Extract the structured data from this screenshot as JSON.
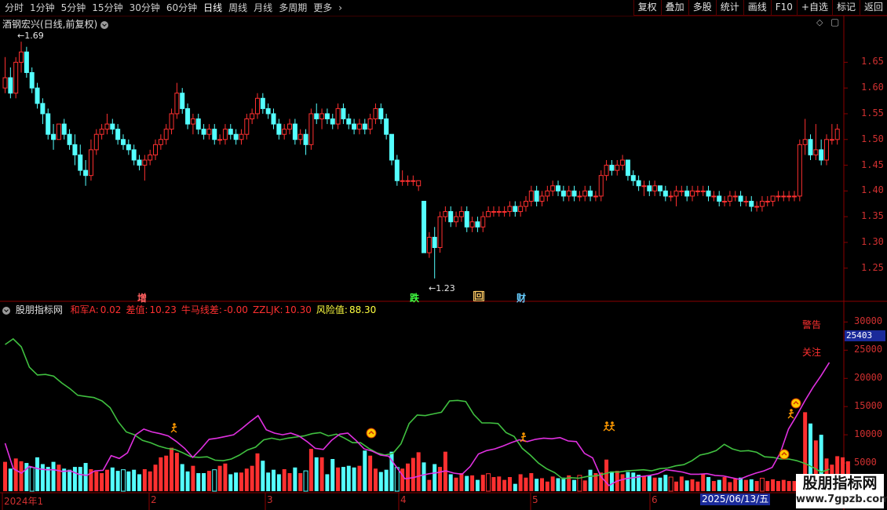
{
  "toolbar": {
    "periods": [
      "分时",
      "1分钟",
      "5分钟",
      "15分钟",
      "30分钟",
      "60分钟",
      "日线",
      "周线",
      "月线",
      "多周期",
      "更多"
    ],
    "active": "日线",
    "buttons": [
      "复权",
      "叠加",
      "多股",
      "统计",
      "画线",
      "F10",
      "+自选",
      "标记",
      "返回"
    ]
  },
  "stock": {
    "title": "酒钢宏兴(日线,前复权)",
    "high_label": "1.69",
    "low_label": "1.23"
  },
  "event_marks": [
    {
      "text": "增",
      "color": "#ff6060"
    },
    {
      "text": "跌",
      "color": "#40ff40"
    },
    {
      "text": "回",
      "color": "#ffcc66"
    },
    {
      "text": "财",
      "color": "#66ccff"
    }
  ],
  "price_axis": [
    "1.65",
    "1.60",
    "1.55",
    "1.50",
    "1.45",
    "1.40",
    "1.35",
    "1.30",
    "1.25"
  ],
  "indicator": {
    "name": "股朋指标网",
    "items": [
      {
        "label": "和军A:",
        "value": "0.02",
        "color": "#ff3030"
      },
      {
        "label": "差值:",
        "value": "10.23",
        "color": "#ff3030"
      },
      {
        "label": "牛马线差:",
        "value": "-0.00",
        "color": "#ff3030"
      },
      {
        "label": "ZZLJK:",
        "value": "10.30",
        "color": "#ff3030"
      },
      {
        "label": "风险值:",
        "value": "88.30",
        "color": "#ffff40"
      }
    ],
    "warning_label": "警告",
    "focus_label": "关注"
  },
  "volume_axis": [
    "30000",
    "25000",
    "20000",
    "15000",
    "10000",
    "5000"
  ],
  "highlight_value": "25403",
  "x_axis": [
    "2024年1",
    "2",
    "3",
    "4",
    "5",
    "6"
  ],
  "date_label": "2025/06/13/五",
  "brand": {
    "title": "股朋指标网",
    "url": "www.7gpzb.com"
  },
  "colors": {
    "up": "#ff3030",
    "down": "#54ffff",
    "green_line": "#40c040",
    "magenta_line": "#e030e0",
    "grid": "#8b0000"
  },
  "chart_data": {
    "type": "candlestick",
    "candles": [
      [
        1.6,
        1.66,
        1.59,
        1.62
      ],
      [
        1.62,
        1.64,
        1.58,
        1.59
      ],
      [
        1.59,
        1.66,
        1.58,
        1.65
      ],
      [
        1.65,
        1.69,
        1.63,
        1.67
      ],
      [
        1.67,
        1.68,
        1.62,
        1.63
      ],
      [
        1.63,
        1.64,
        1.59,
        1.6
      ],
      [
        1.6,
        1.61,
        1.56,
        1.57
      ],
      [
        1.57,
        1.58,
        1.53,
        1.55
      ],
      [
        1.55,
        1.56,
        1.5,
        1.51
      ],
      [
        1.51,
        1.53,
        1.48,
        1.5
      ],
      [
        1.5,
        1.53,
        1.5,
        1.53
      ],
      [
        1.53,
        1.54,
        1.5,
        1.51
      ],
      [
        1.51,
        1.52,
        1.48,
        1.49
      ],
      [
        1.49,
        1.51,
        1.45,
        1.47
      ],
      [
        1.47,
        1.49,
        1.43,
        1.44
      ],
      [
        1.44,
        1.46,
        1.41,
        1.43
      ],
      [
        1.43,
        1.5,
        1.42,
        1.48
      ],
      [
        1.48,
        1.52,
        1.47,
        1.51
      ],
      [
        1.51,
        1.53,
        1.5,
        1.52
      ],
      [
        1.52,
        1.55,
        1.51,
        1.53
      ],
      [
        1.53,
        1.54,
        1.51,
        1.52
      ],
      [
        1.52,
        1.53,
        1.49,
        1.5
      ],
      [
        1.5,
        1.51,
        1.48,
        1.49
      ],
      [
        1.49,
        1.5,
        1.47,
        1.48
      ],
      [
        1.48,
        1.49,
        1.45,
        1.46
      ],
      [
        1.46,
        1.47,
        1.44,
        1.45
      ],
      [
        1.45,
        1.47,
        1.42,
        1.46
      ],
      [
        1.46,
        1.48,
        1.45,
        1.47
      ],
      [
        1.47,
        1.5,
        1.46,
        1.49
      ],
      [
        1.49,
        1.51,
        1.48,
        1.5
      ],
      [
        1.5,
        1.53,
        1.49,
        1.52
      ],
      [
        1.52,
        1.56,
        1.51,
        1.55
      ],
      [
        1.55,
        1.61,
        1.54,
        1.59
      ],
      [
        1.59,
        1.6,
        1.55,
        1.56
      ],
      [
        1.56,
        1.57,
        1.52,
        1.53
      ],
      [
        1.53,
        1.55,
        1.51,
        1.54
      ],
      [
        1.54,
        1.55,
        1.51,
        1.52
      ],
      [
        1.52,
        1.53,
        1.5,
        1.51
      ],
      [
        1.51,
        1.53,
        1.5,
        1.52
      ],
      [
        1.52,
        1.53,
        1.49,
        1.5
      ],
      [
        1.5,
        1.51,
        1.49,
        1.5
      ],
      [
        1.5,
        1.53,
        1.49,
        1.52
      ],
      [
        1.52,
        1.53,
        1.5,
        1.51
      ],
      [
        1.51,
        1.52,
        1.49,
        1.5
      ],
      [
        1.5,
        1.52,
        1.49,
        1.51
      ],
      [
        1.51,
        1.55,
        1.5,
        1.54
      ],
      [
        1.54,
        1.56,
        1.53,
        1.55
      ],
      [
        1.55,
        1.59,
        1.54,
        1.58
      ],
      [
        1.58,
        1.59,
        1.55,
        1.56
      ],
      [
        1.56,
        1.57,
        1.54,
        1.55
      ],
      [
        1.55,
        1.56,
        1.52,
        1.53
      ],
      [
        1.53,
        1.54,
        1.5,
        1.51
      ],
      [
        1.51,
        1.53,
        1.5,
        1.52
      ],
      [
        1.52,
        1.54,
        1.51,
        1.53
      ],
      [
        1.53,
        1.54,
        1.49,
        1.5
      ],
      [
        1.5,
        1.52,
        1.49,
        1.51
      ],
      [
        1.51,
        1.52,
        1.47,
        1.49
      ],
      [
        1.49,
        1.56,
        1.48,
        1.55
      ],
      [
        1.55,
        1.57,
        1.53,
        1.54
      ],
      [
        1.54,
        1.56,
        1.52,
        1.55
      ],
      [
        1.55,
        1.56,
        1.53,
        1.54
      ],
      [
        1.54,
        1.55,
        1.52,
        1.53
      ],
      [
        1.53,
        1.57,
        1.52,
        1.56
      ],
      [
        1.56,
        1.57,
        1.53,
        1.54
      ],
      [
        1.54,
        1.55,
        1.52,
        1.53
      ],
      [
        1.53,
        1.54,
        1.51,
        1.52
      ],
      [
        1.52,
        1.54,
        1.51,
        1.53
      ],
      [
        1.53,
        1.54,
        1.51,
        1.52
      ],
      [
        1.52,
        1.55,
        1.51,
        1.54
      ],
      [
        1.54,
        1.57,
        1.53,
        1.56
      ],
      [
        1.56,
        1.57,
        1.53,
        1.54
      ],
      [
        1.54,
        1.55,
        1.5,
        1.51
      ],
      [
        1.51,
        1.51,
        1.45,
        1.46
      ],
      [
        1.46,
        1.47,
        1.41,
        1.42
      ],
      [
        1.42,
        1.44,
        1.41,
        1.42
      ],
      [
        1.42,
        1.43,
        1.41,
        1.42
      ],
      [
        1.42,
        1.43,
        1.41,
        1.42
      ],
      [
        1.41,
        1.42,
        1.4,
        1.42
      ],
      [
        1.38,
        1.38,
        1.28,
        1.28
      ],
      [
        1.28,
        1.32,
        1.27,
        1.31
      ],
      [
        1.31,
        1.33,
        1.23,
        1.29
      ],
      [
        1.29,
        1.36,
        1.28,
        1.35
      ],
      [
        1.35,
        1.37,
        1.34,
        1.36
      ],
      [
        1.36,
        1.37,
        1.33,
        1.34
      ],
      [
        1.34,
        1.36,
        1.33,
        1.35
      ],
      [
        1.35,
        1.37,
        1.34,
        1.36
      ],
      [
        1.36,
        1.37,
        1.32,
        1.33
      ],
      [
        1.33,
        1.35,
        1.32,
        1.34
      ],
      [
        1.34,
        1.35,
        1.32,
        1.33
      ],
      [
        1.33,
        1.36,
        1.32,
        1.35
      ],
      [
        1.35,
        1.37,
        1.35,
        1.36
      ],
      [
        1.36,
        1.37,
        1.35,
        1.36
      ],
      [
        1.36,
        1.37,
        1.35,
        1.36
      ],
      [
        1.36,
        1.37,
        1.35,
        1.36
      ],
      [
        1.36,
        1.38,
        1.35,
        1.37
      ],
      [
        1.37,
        1.38,
        1.35,
        1.36
      ],
      [
        1.36,
        1.38,
        1.35,
        1.37
      ],
      [
        1.37,
        1.39,
        1.36,
        1.38
      ],
      [
        1.38,
        1.41,
        1.37,
        1.4
      ],
      [
        1.4,
        1.41,
        1.37,
        1.38
      ],
      [
        1.38,
        1.4,
        1.37,
        1.39
      ],
      [
        1.39,
        1.41,
        1.38,
        1.4
      ],
      [
        1.4,
        1.42,
        1.39,
        1.41
      ],
      [
        1.41,
        1.42,
        1.39,
        1.4
      ],
      [
        1.4,
        1.41,
        1.38,
        1.39
      ],
      [
        1.39,
        1.41,
        1.38,
        1.4
      ],
      [
        1.4,
        1.41,
        1.38,
        1.39
      ],
      [
        1.39,
        1.4,
        1.38,
        1.39
      ],
      [
        1.39,
        1.41,
        1.38,
        1.4
      ],
      [
        1.4,
        1.41,
        1.38,
        1.39
      ],
      [
        1.39,
        1.4,
        1.38,
        1.39
      ],
      [
        1.39,
        1.44,
        1.38,
        1.43
      ],
      [
        1.43,
        1.46,
        1.42,
        1.45
      ],
      [
        1.45,
        1.46,
        1.43,
        1.44
      ],
      [
        1.44,
        1.46,
        1.43,
        1.45
      ],
      [
        1.45,
        1.47,
        1.44,
        1.46
      ],
      [
        1.46,
        1.46,
        1.42,
        1.43
      ],
      [
        1.43,
        1.44,
        1.41,
        1.42
      ],
      [
        1.42,
        1.43,
        1.4,
        1.41
      ],
      [
        1.41,
        1.42,
        1.39,
        1.41
      ],
      [
        1.41,
        1.42,
        1.39,
        1.4
      ],
      [
        1.4,
        1.42,
        1.39,
        1.41
      ],
      [
        1.41,
        1.41,
        1.39,
        1.4
      ],
      [
        1.4,
        1.41,
        1.38,
        1.39
      ],
      [
        1.39,
        1.4,
        1.38,
        1.39
      ],
      [
        1.39,
        1.41,
        1.37,
        1.4
      ],
      [
        1.4,
        1.41,
        1.39,
        1.4
      ],
      [
        1.4,
        1.41,
        1.38,
        1.39
      ],
      [
        1.39,
        1.41,
        1.38,
        1.4
      ],
      [
        1.4,
        1.41,
        1.39,
        1.4
      ],
      [
        1.4,
        1.41,
        1.39,
        1.4
      ],
      [
        1.4,
        1.41,
        1.38,
        1.39
      ],
      [
        1.39,
        1.4,
        1.38,
        1.39
      ],
      [
        1.39,
        1.4,
        1.37,
        1.38
      ],
      [
        1.38,
        1.39,
        1.37,
        1.38
      ],
      [
        1.38,
        1.4,
        1.37,
        1.39
      ],
      [
        1.39,
        1.4,
        1.38,
        1.39
      ],
      [
        1.39,
        1.4,
        1.37,
        1.38
      ],
      [
        1.38,
        1.39,
        1.37,
        1.38
      ],
      [
        1.38,
        1.39,
        1.36,
        1.37
      ],
      [
        1.37,
        1.38,
        1.36,
        1.37
      ],
      [
        1.37,
        1.39,
        1.36,
        1.38
      ],
      [
        1.38,
        1.39,
        1.37,
        1.38
      ],
      [
        1.38,
        1.39,
        1.37,
        1.39
      ],
      [
        1.39,
        1.4,
        1.38,
        1.39
      ],
      [
        1.39,
        1.4,
        1.38,
        1.39
      ],
      [
        1.39,
        1.4,
        1.38,
        1.39
      ],
      [
        1.39,
        1.4,
        1.38,
        1.39
      ],
      [
        1.39,
        1.5,
        1.38,
        1.49
      ],
      [
        1.49,
        1.54,
        1.47,
        1.5
      ],
      [
        1.5,
        1.51,
        1.46,
        1.47
      ],
      [
        1.47,
        1.53,
        1.46,
        1.48
      ],
      [
        1.48,
        1.5,
        1.45,
        1.46
      ],
      [
        1.46,
        1.51,
        1.45,
        1.5
      ],
      [
        1.5,
        1.53,
        1.49,
        1.5
      ],
      [
        1.5,
        1.53,
        1.49,
        1.52
      ]
    ],
    "volume": [
      5200,
      4000,
      5800,
      5300,
      5000,
      4200,
      6000,
      4800,
      4300,
      5200,
      4700,
      4000,
      3800,
      4300,
      4300,
      5000,
      3900,
      3500,
      3200,
      3800,
      4200,
      3600,
      3800,
      3500,
      3800,
      3000,
      3900,
      3500,
      4700,
      6000,
      6300,
      7700,
      6800,
      4800,
      3500,
      4500,
      3200,
      3200,
      3600,
      3800,
      4500,
      4900,
      3000,
      3300,
      3300,
      4000,
      4500,
      6700,
      5400,
      3300,
      3800,
      3000,
      3900,
      3200,
      4200,
      3200,
      3600,
      7500,
      6000,
      6000,
      3000,
      5700,
      4200,
      4300,
      4500,
      4200,
      4500,
      7200,
      6300,
      4000,
      3400,
      3800,
      7000,
      4200,
      4000,
      4900,
      5900,
      6900,
      5100,
      2000,
      4800,
      4300,
      7000,
      3000,
      2400,
      3200,
      2700,
      2800,
      2000,
      2900,
      3100,
      2500,
      2600,
      2000,
      2500,
      1300,
      3000,
      2400,
      3200,
      2200,
      2300,
      1700,
      2600,
      2300,
      2400,
      2800,
      2000,
      2800,
      1900,
      3800,
      3200,
      3300,
      5600,
      3500,
      3600,
      3000,
      3400,
      3300,
      2900,
      2600,
      2800,
      2400,
      2400,
      2900,
      2500,
      1700,
      2600,
      1900,
      2100,
      1700,
      3000,
      2500,
      1800,
      2000,
      2500,
      1600,
      2200,
      2400,
      2000,
      2100,
      1800,
      2300,
      1800,
      2100,
      1800,
      2000,
      1800,
      1800,
      2000,
      14000,
      12000,
      9000,
      10000,
      5800,
      4700,
      6200,
      6000,
      5300
    ],
    "green_line": [
      26000,
      27000,
      25600,
      22000,
      20600,
      20700,
      20400,
      19200,
      18200,
      17000,
      16800,
      16600,
      16000,
      14800,
      12300,
      10500,
      10000,
      9000,
      8600,
      8000,
      7600,
      7400,
      6800,
      6100,
      6000,
      6100,
      5500,
      5400,
      5700,
      6400,
      7300,
      7800,
      9100,
      9400,
      9100,
      9400,
      9600,
      9800,
      10200,
      10400,
      9800,
      10100,
      9400,
      8600,
      8600,
      7600,
      6800,
      6400,
      6700,
      8400,
      12000,
      13500,
      13400,
      13700,
      14000,
      16000,
      16100,
      15900,
      13600,
      12100,
      12100,
      12000,
      10400,
      9700,
      7600,
      6400,
      5000,
      4000,
      3300,
      2200,
      2400,
      2300,
      2600,
      2700,
      3000,
      3400,
      3400,
      3600,
      3700,
      3800,
      3600,
      4000,
      4100,
      4500,
      4700,
      5400,
      6400,
      6700,
      7200,
      8300,
      7500,
      7100,
      7200,
      6900,
      6100,
      6000,
      5700,
      5700,
      5400,
      4900,
      4200,
      3400,
      3900
    ],
    "magenta_line": [
      8500,
      4000,
      3200,
      4400,
      4000,
      3800,
      3800,
      3500,
      3600,
      3000,
      2800,
      3600,
      3700,
      6300,
      5800,
      6800,
      10000,
      11000,
      10500,
      10200,
      9800,
      8800,
      7600,
      6000,
      7500,
      9200,
      9400,
      9700,
      10000,
      11100,
      12300,
      13400,
      10900,
      10300,
      10000,
      10300,
      9800,
      8800,
      7600,
      7400,
      9000,
      10100,
      10300,
      9000,
      7500,
      7100,
      6400,
      6200,
      4200,
      2200,
      2400,
      2800,
      3100,
      3300,
      3600,
      3200,
      3000,
      4400,
      6600,
      7200,
      7500,
      8000,
      8600,
      9100,
      8800,
      9200,
      9400,
      9300,
      9500,
      8900,
      8800,
      6700,
      5900,
      2600,
      1000,
      1800,
      2200,
      2400,
      2600,
      2800,
      3100,
      3800,
      3600,
      3400,
      3000,
      3000,
      3100,
      2800,
      2700,
      2400,
      2100,
      2700,
      3200,
      3600,
      4200,
      6800,
      11000,
      13400,
      16000,
      18400,
      20500,
      22800
    ],
    "price_ylim": [
      1.21,
      1.71
    ],
    "volume_ylim": [
      0,
      32000
    ]
  }
}
